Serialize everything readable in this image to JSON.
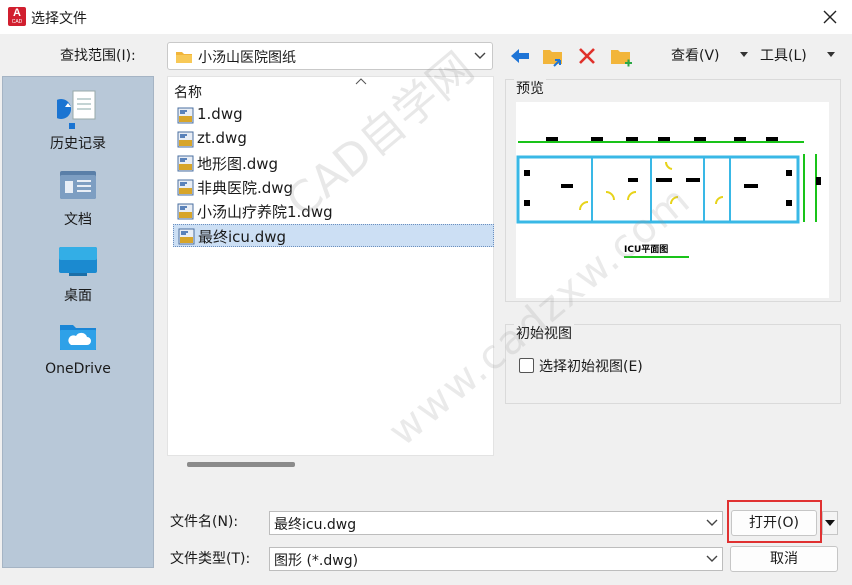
{
  "window": {
    "title": "选择文件",
    "app_icon_text": "A",
    "app_icon_sub": "CAD"
  },
  "toolbar": {
    "look_in_label": "查找范围(I):",
    "look_in_value": "小汤山医院图纸",
    "view_menu": "查看(V)",
    "tools_menu": "工具(L)"
  },
  "places": [
    {
      "label": "历史记录",
      "icon": "history-icon"
    },
    {
      "label": "文档",
      "icon": "documents-icon"
    },
    {
      "label": "桌面",
      "icon": "desktop-icon"
    },
    {
      "label": "OneDrive",
      "icon": "onedrive-icon"
    }
  ],
  "file_list": {
    "column_header": "名称",
    "files": [
      "1.dwg",
      "zt.dwg",
      "地形图.dwg",
      "非典医院.dwg",
      "小汤山疗养院1.dwg",
      "最终icu.dwg"
    ],
    "selected_index": 5
  },
  "preview": {
    "label": "预览",
    "drawing_caption": "ICU平面图"
  },
  "initial_view": {
    "label": "初始视图",
    "checkbox_label": "选择初始视图(E)",
    "checked": false
  },
  "file_name": {
    "label": "文件名(N):",
    "value": "最终icu.dwg"
  },
  "file_type": {
    "label": "文件类型(T):",
    "value": "图形 (*.dwg)"
  },
  "buttons": {
    "open": "打开(O)",
    "cancel": "取消"
  },
  "watermark": {
    "line1": "CAD自学网",
    "line2": "www.cadzxw.com"
  },
  "colors": {
    "accent": "#0a64d6",
    "delete": "#e0302a",
    "folder": "#f2b53a",
    "highlight": "#e03131",
    "places_bg": "#b8c8d8"
  }
}
